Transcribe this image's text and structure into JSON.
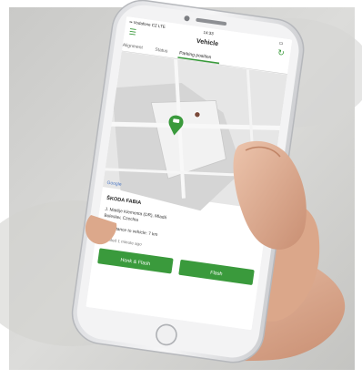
{
  "status_bar": {
    "carrier": "•• Vodafone CZ  LTE",
    "time": "14:33",
    "battery": "▭"
  },
  "app": {
    "title": "Vehicle",
    "tabs": [
      {
        "label": "Alignment"
      },
      {
        "label": "Status"
      },
      {
        "label": "Parking position",
        "active": true
      }
    ]
  },
  "map": {
    "provider": "Google"
  },
  "vehicle": {
    "name": "ŠKODA FABIA",
    "address_line1": "J. Matěje Klementa (DR), Mladá",
    "address_line2": "Boleslav, Czechia",
    "distance": "Distance to vehicle: 7 km",
    "updated": "Updated 1 minute ago"
  },
  "actions": {
    "honk_flash": "Honk & Flash",
    "flash": "Flash"
  },
  "colors": {
    "accent": "#3a9a3c",
    "map_bg": "#e6e6e6"
  }
}
